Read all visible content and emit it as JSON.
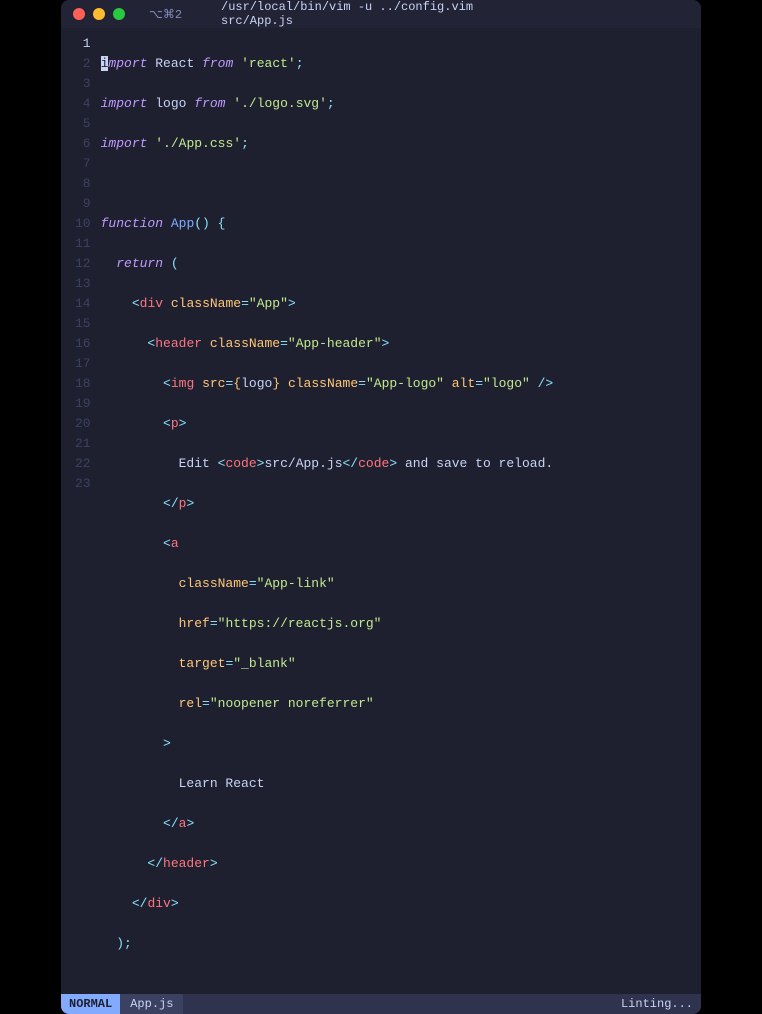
{
  "titlebar": {
    "tab_indicator": "⌥⌘2",
    "title": "/usr/local/bin/vim -u ../config.vim src/App.js"
  },
  "gutter": {
    "lines": [
      "1",
      "2",
      "3",
      "4",
      "5",
      "6",
      "7",
      "8",
      "9",
      "10",
      "11",
      "12",
      "13",
      "14",
      "15",
      "16",
      "17",
      "18",
      "19",
      "20",
      "21",
      "22",
      "23"
    ]
  },
  "code": {
    "l1": {
      "import": "import",
      "react": "React",
      "from": "from",
      "str": "'react'",
      "semi": ";"
    },
    "l2": {
      "import": "import",
      "logo": "logo",
      "from": "from",
      "str": "'./logo.svg'",
      "semi": ";"
    },
    "l3": {
      "import": "import",
      "str": "'./App.css'",
      "semi": ";"
    },
    "l5": {
      "fn": "function",
      "name": "App",
      "parens": "()",
      "brace": "{"
    },
    "l6": {
      "ret": "return",
      "paren": "("
    },
    "l7": {
      "lt": "<",
      "tag": "div",
      "sp": " ",
      "attr": "className",
      "eq": "=",
      "val": "\"App\"",
      "gt": ">"
    },
    "l8": {
      "lt": "<",
      "tag": "header",
      "sp": " ",
      "attr": "className",
      "eq": "=",
      "val": "\"App-header\"",
      "gt": ">"
    },
    "l9": {
      "lt": "<",
      "tag": "img",
      "sp": " ",
      "a1": "src",
      "eq1": "=",
      "b1": "{",
      "v1": "logo",
      "b2": "}",
      "sp2": " ",
      "a2": "className",
      "eq2": "=",
      "v2": "\"App-logo\"",
      "sp3": " ",
      "a3": "alt",
      "eq3": "=",
      "v3": "\"logo\"",
      "close": " />"
    },
    "l10": {
      "lt": "<",
      "tag": "p",
      "gt": ">"
    },
    "l11": {
      "txt1": "Edit ",
      "lt": "<",
      "code": "code",
      "gt": ">",
      "txt2": "src/App.js",
      "lt2": "</",
      "code2": "code",
      "gt2": ">",
      "txt3": " and save to reload."
    },
    "l12": {
      "lt": "</",
      "tag": "p",
      "gt": ">"
    },
    "l13": {
      "lt": "<",
      "tag": "a"
    },
    "l14": {
      "attr": "className",
      "eq": "=",
      "val": "\"App-link\""
    },
    "l15": {
      "attr": "href",
      "eq": "=",
      "val": "\"https://reactjs.org\""
    },
    "l16": {
      "attr": "target",
      "eq": "=",
      "val": "\"_blank\""
    },
    "l17": {
      "attr": "rel",
      "eq": "=",
      "val": "\"noopener noreferrer\""
    },
    "l18": {
      "gt": ">"
    },
    "l19": {
      "txt": "Learn React"
    },
    "l20": {
      "lt": "</",
      "tag": "a",
      "gt": ">"
    },
    "l21": {
      "lt": "</",
      "tag": "header",
      "gt": ">"
    },
    "l22": {
      "lt": "</",
      "tag": "div",
      "gt": ">"
    },
    "l23": {
      "paren": ")",
      "semi": ";"
    }
  },
  "statusbar": {
    "mode": "NORMAL",
    "filename": "App.js",
    "right": "Linting..."
  }
}
